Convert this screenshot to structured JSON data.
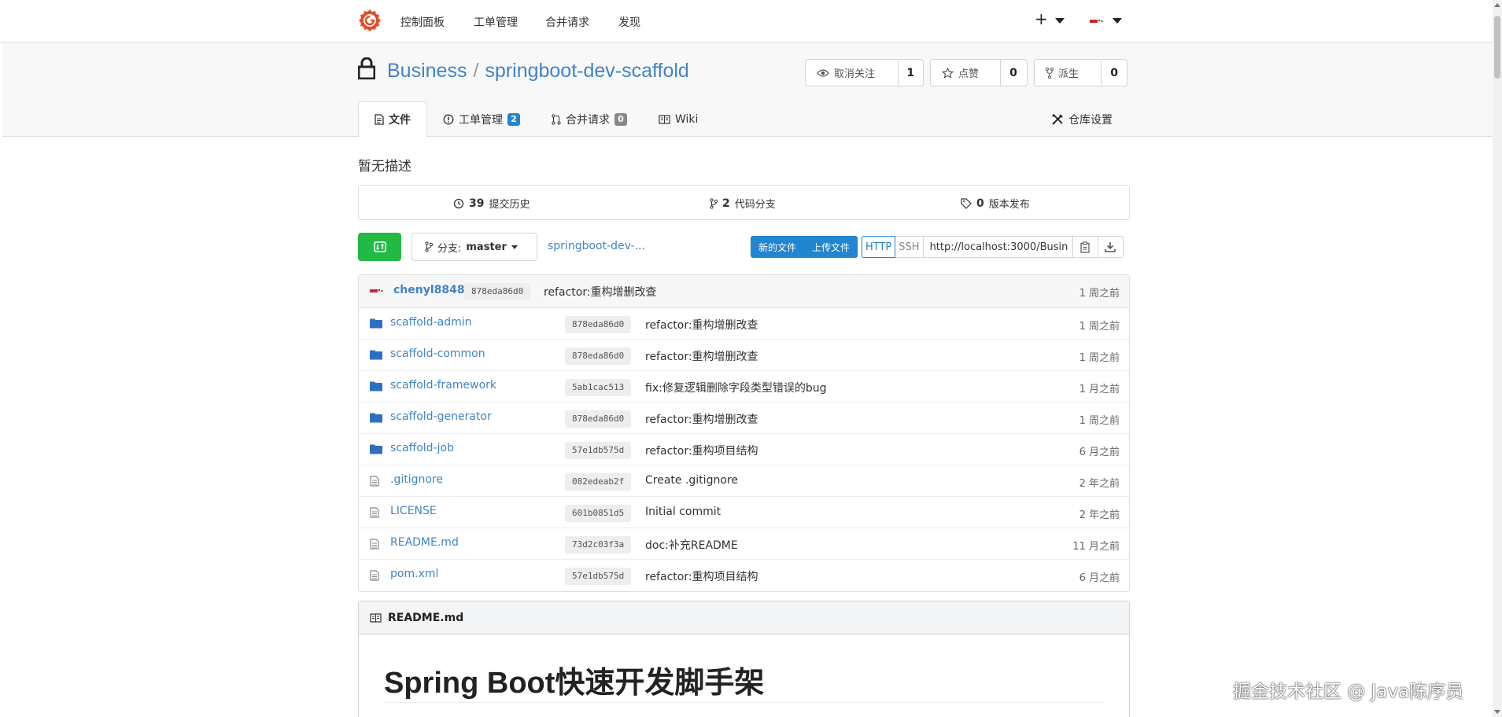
{
  "nav": {
    "items": [
      "控制面板",
      "工单管理",
      "合并请求",
      "发现"
    ],
    "plus": "+"
  },
  "repo": {
    "owner": "Business",
    "separator": "/",
    "name": "springboot-dev-scaffold",
    "watch_label": "取消关注",
    "watch_count": "1",
    "star_label": "点赞",
    "star_count": "0",
    "fork_label": "派生",
    "fork_count": "0"
  },
  "tabs": [
    {
      "label": "文件",
      "icon": "file-code-icon",
      "active": true
    },
    {
      "label": "工单管理",
      "icon": "issue-icon",
      "badge": "2"
    },
    {
      "label": "合并请求",
      "icon": "pull-request-icon",
      "badge": "0"
    },
    {
      "label": "Wiki",
      "icon": "book-icon"
    }
  ],
  "settings_label": "仓库设置",
  "description": "暂无描述",
  "stats": {
    "commits_count": "39",
    "commits_label": "提交历史",
    "branches_count": "2",
    "branches_label": "代码分支",
    "releases_count": "0",
    "releases_label": "版本发布"
  },
  "toolbar": {
    "branch_prefix": "分支:",
    "branch_name": "master",
    "path": "springboot-dev-...",
    "new_file": "新的文件",
    "upload_file": "上传文件",
    "http": "HTTP",
    "ssh": "SSH",
    "clone_url": "http://localhost:3000/Busin"
  },
  "latest_commit": {
    "author": "chenyl8848",
    "sha": "878eda86d0",
    "message": "refactor:重构增删改查",
    "ago": "1 周之前"
  },
  "files": [
    {
      "name": "scaffold-admin",
      "type": "dir",
      "sha": "878eda86d0",
      "message": "refactor:重构增删改查",
      "ago": "1 周之前"
    },
    {
      "name": "scaffold-common",
      "type": "dir",
      "sha": "878eda86d0",
      "message": "refactor:重构增删改查",
      "ago": "1 周之前"
    },
    {
      "name": "scaffold-framework",
      "type": "dir",
      "sha": "5ab1cac513",
      "message": "fix:修复逻辑删除字段类型错误的bug",
      "ago": "1 月之前"
    },
    {
      "name": "scaffold-generator",
      "type": "dir",
      "sha": "878eda86d0",
      "message": "refactor:重构增删改查",
      "ago": "1 周之前"
    },
    {
      "name": "scaffold-job",
      "type": "dir",
      "sha": "57e1db575d",
      "message": "refactor:重构项目结构",
      "ago": "6 月之前"
    },
    {
      "name": ".gitignore",
      "type": "file",
      "sha": "082edeab2f",
      "message": "Create .gitignore",
      "ago": "2 年之前"
    },
    {
      "name": "LICENSE",
      "type": "file",
      "sha": "601b0851d5",
      "message": "Initial commit",
      "ago": "2 年之前"
    },
    {
      "name": "README.md",
      "type": "file",
      "sha": "73d2c03f3a",
      "message": "doc:补充README",
      "ago": "11 月之前"
    },
    {
      "name": "pom.xml",
      "type": "file",
      "sha": "57e1db575d",
      "message": "refactor:重构项目结构",
      "ago": "6 月之前"
    }
  ],
  "readme": {
    "filename": "README.md",
    "heading": "Spring Boot快速开发脚手架"
  },
  "watermark": "掘金技术社区 @ Java陈序员",
  "colors": {
    "link": "#4183c4",
    "primary": "#2185d0",
    "success": "#21ba45",
    "logo": "#e34c26"
  }
}
